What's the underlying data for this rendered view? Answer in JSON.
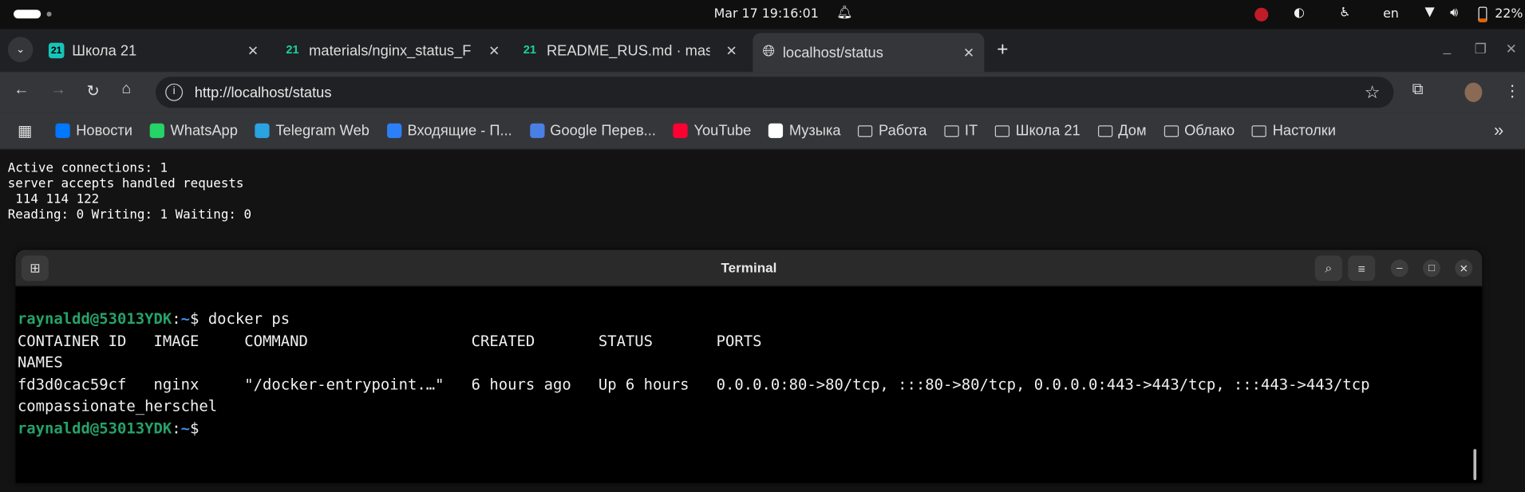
{
  "topbar": {
    "datetime": "Mar 17  19:16:01",
    "lang": "en",
    "battery": "22%"
  },
  "tabs": [
    {
      "title": "Школа 21",
      "active": false
    },
    {
      "title": "materials/nginx_status_F",
      "active": false
    },
    {
      "title": "README_RUS.md · maste",
      "active": false
    },
    {
      "title": "localhost/status",
      "active": true
    }
  ],
  "address": {
    "url": "http://localhost/status"
  },
  "bookmarks": [
    {
      "label": "Новости",
      "color": "#0077ff",
      "icon": "vk-icon"
    },
    {
      "label": "WhatsApp",
      "color": "#25d366",
      "icon": "whatsapp-icon"
    },
    {
      "label": "Telegram Web",
      "color": "#2aa3e0",
      "icon": "telegram-icon"
    },
    {
      "label": "Входящие - П...",
      "color": "#2d7ff9",
      "icon": "mail-icon"
    },
    {
      "label": "Google Перев...",
      "color": "#4a7fe6",
      "icon": "translate-icon"
    },
    {
      "label": "YouTube",
      "color": "#ff0033",
      "icon": "youtube-icon"
    },
    {
      "label": "Музыка",
      "color": "#ffffff",
      "icon": "music-icon"
    },
    {
      "label": "Работа",
      "icon": "folder-icon"
    },
    {
      "label": "IT",
      "icon": "folder-icon"
    },
    {
      "label": "Школа 21",
      "icon": "folder-icon"
    },
    {
      "label": "Дом",
      "icon": "folder-icon"
    },
    {
      "label": "Облако",
      "icon": "folder-icon"
    },
    {
      "label": "Настолки",
      "icon": "folder-icon"
    }
  ],
  "page": {
    "lines": [
      "Active connections: 1",
      "server accepts handled requests",
      " 114 114 122",
      "Reading: 0 Writing: 1 Waiting: 0"
    ]
  },
  "terminal": {
    "title": "Terminal",
    "prompt_user": "raynaldd@53013YDK",
    "prompt_path": "~",
    "command": "docker ps",
    "header": "CONTAINER ID   IMAGE     COMMAND                  CREATED       STATUS       PORTS",
    "header2": "NAMES",
    "row": "fd3d0cac59cf   nginx     \"/docker-entrypoint.…\"   6 hours ago   Up 6 hours   0.0.0.0:80->80/tcp, :::80->80/tcp, 0.0.0.0:443->443/tcp, :::443->443/tcp",
    "row2": "compassionate_herschel"
  }
}
